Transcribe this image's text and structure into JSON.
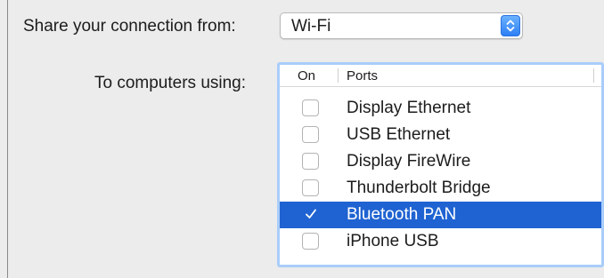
{
  "share": {
    "label": "Share your connection from:",
    "selected": "Wi-Fi"
  },
  "computers": {
    "label": "To computers using:"
  },
  "table": {
    "headers": {
      "on": "On",
      "ports": "Ports"
    },
    "rows": [
      {
        "name": "Display Ethernet",
        "on": false,
        "selected": false
      },
      {
        "name": "USB Ethernet",
        "on": false,
        "selected": false
      },
      {
        "name": "Display FireWire",
        "on": false,
        "selected": false
      },
      {
        "name": "Thunderbolt Bridge",
        "on": false,
        "selected": false
      },
      {
        "name": "Bluetooth PAN",
        "on": true,
        "selected": true
      },
      {
        "name": "iPhone USB",
        "on": false,
        "selected": false
      }
    ]
  },
  "colors": {
    "selection": "#1f63d2",
    "focus_ring": "#a9cdfa",
    "stepper": "#2d7ff5"
  },
  "icons": {
    "stepper": "chevron-up-down-icon",
    "check": "checkmark-icon"
  }
}
